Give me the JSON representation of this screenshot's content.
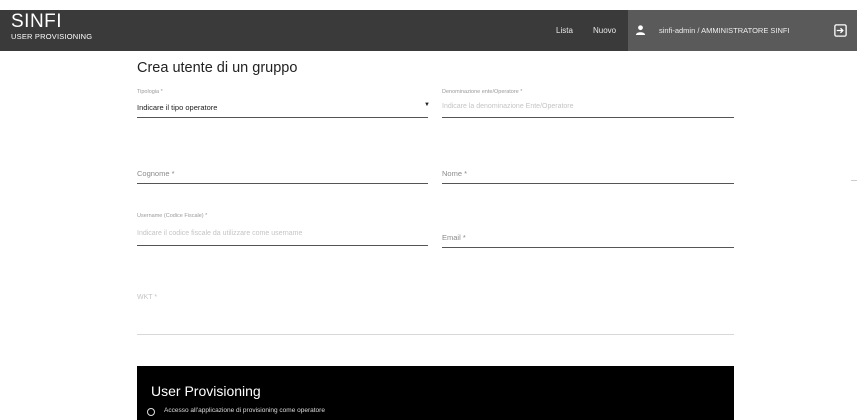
{
  "header": {
    "brand_title": "SINFI",
    "brand_subtitle": "USER PROVISIONING",
    "nav": {
      "lista": "Lista",
      "nuovo": "Nuovo"
    },
    "user_label": "sinfi-admin / AMMINISTRATORE SINFI",
    "icons": {
      "user": "user-icon",
      "logout": "logout-icon"
    },
    "colors": {
      "bar": "#3a3a3a",
      "user_area": "#5a5a5a"
    }
  },
  "form": {
    "title": "Crea utente di un gruppo",
    "tipologia": {
      "label": "Tipologia *",
      "value": "Indicare il tipo operatore"
    },
    "denominazione": {
      "label": "Denominazione ente/Operatore *",
      "placeholder": "Indicare la denominazione Ente/Operatore"
    },
    "cognome": {
      "label": "Cognome *"
    },
    "nome": {
      "label": "Nome *"
    },
    "username": {
      "label": "Username (Codice Fiscale) *",
      "placeholder": "Indicare il codice fiscale da utilizzare come username"
    },
    "email": {
      "label": "Email *"
    },
    "wkt": {
      "label": "WKT *"
    }
  },
  "provisioning_panel": {
    "title": "User Provisioning",
    "option_label": "Accesso all'applicazione di provisioning come operatore",
    "background": "#000000"
  }
}
